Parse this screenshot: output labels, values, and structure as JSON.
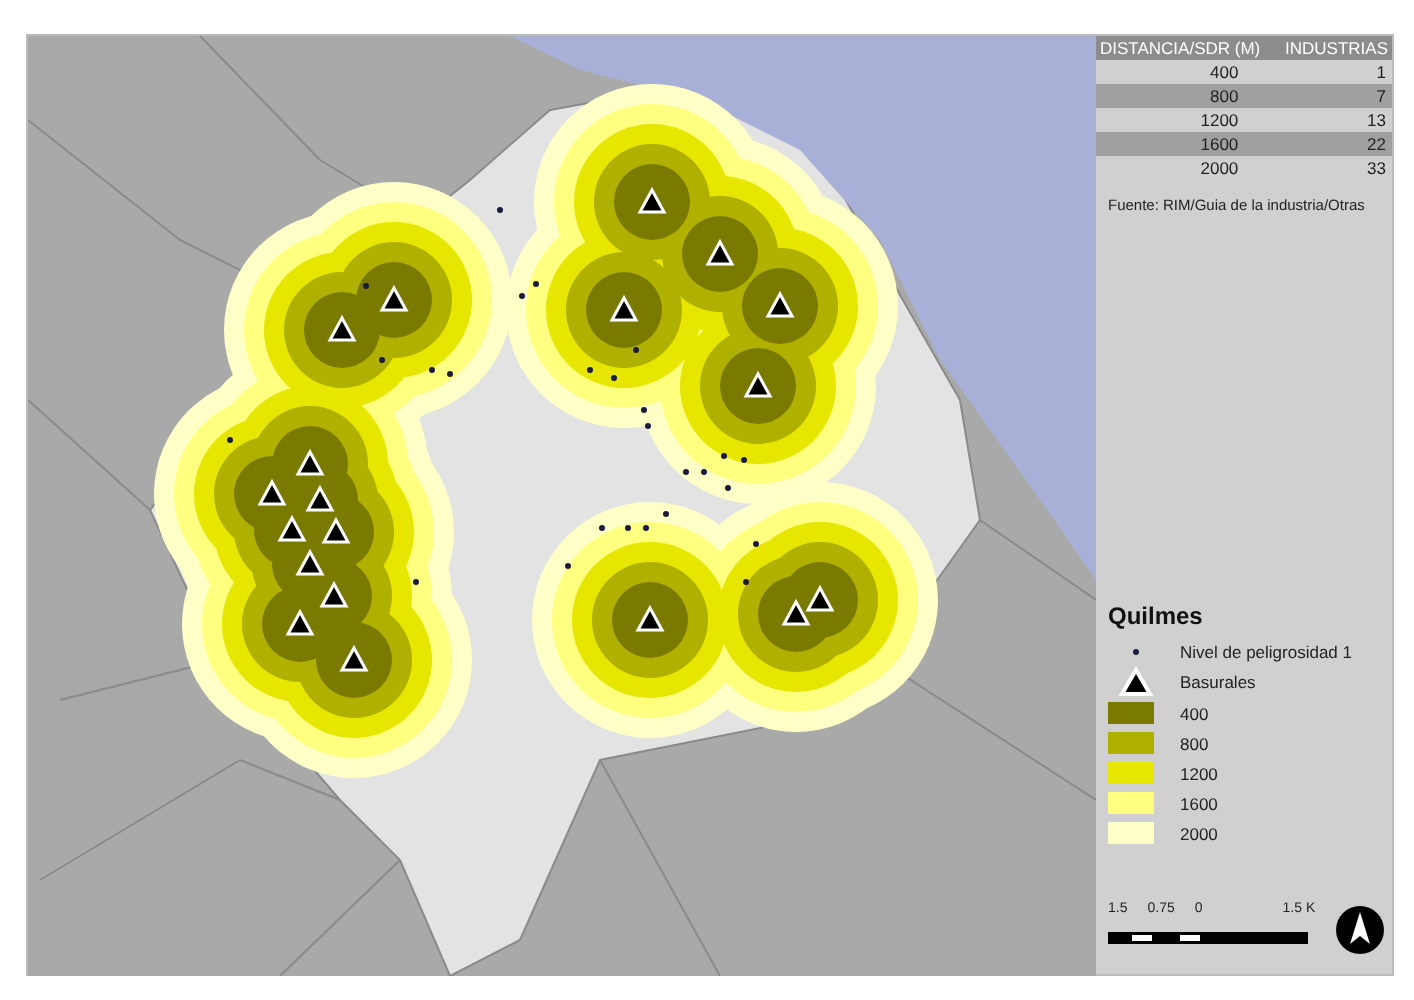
{
  "table": {
    "columns": [
      "DISTANCIA/SDR (M)",
      "INDUSTRIAS"
    ],
    "rows": [
      {
        "cells": [
          "400",
          "1"
        ]
      },
      {
        "cells": [
          "800",
          "7"
        ]
      },
      {
        "cells": [
          "1200",
          "13"
        ]
      },
      {
        "cells": [
          "1600",
          "22"
        ]
      },
      {
        "cells": [
          "2000",
          "33"
        ]
      }
    ]
  },
  "source": "Fuente: RIM/Guia de la industria/Otras",
  "legend": {
    "title": "Quilmes",
    "items": [
      {
        "kind": "point",
        "label": "Nivel de peligrosidad 1"
      },
      {
        "kind": "triangle",
        "label": "Basurales"
      },
      {
        "kind": "fill",
        "label": "400",
        "color": "#7a7a00"
      },
      {
        "kind": "fill",
        "label": "800",
        "color": "#b0b000"
      },
      {
        "kind": "fill",
        "label": "1200",
        "color": "#e6e600"
      },
      {
        "kind": "fill",
        "label": "1600",
        "color": "#ffff80"
      },
      {
        "kind": "fill",
        "label": "2000",
        "color": "#ffffc8"
      }
    ]
  },
  "scale_bar": {
    "labels": [
      "1.5",
      "0.75",
      "0",
      "1.5 K"
    ]
  }
}
